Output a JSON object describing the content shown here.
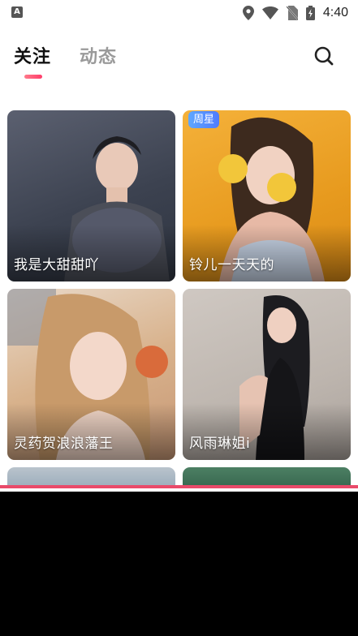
{
  "status_bar": {
    "time": "4:40",
    "icons": [
      "app-notification-icon",
      "location-icon",
      "wifi-icon",
      "no-sim-icon",
      "battery-charging-icon"
    ]
  },
  "header": {
    "tabs": [
      {
        "label": "关注",
        "active": true
      },
      {
        "label": "动态",
        "active": false
      }
    ],
    "search_icon": "search-icon"
  },
  "feed": {
    "cards": [
      {
        "name": "我是大甜甜吖",
        "badge": ""
      },
      {
        "name": "铃儿一天天的",
        "badge": "周星"
      },
      {
        "name": "灵药贺浪浪藩王",
        "badge": ""
      },
      {
        "name": "风雨琳姐i",
        "badge": ""
      },
      {
        "name": "",
        "badge": ""
      },
      {
        "name": "",
        "badge": ""
      }
    ]
  },
  "colors": {
    "accent": "#ff3d6b",
    "badge": "#4f7bff",
    "active_tab": "#111111",
    "inactive_tab": "#9a9a9a"
  }
}
